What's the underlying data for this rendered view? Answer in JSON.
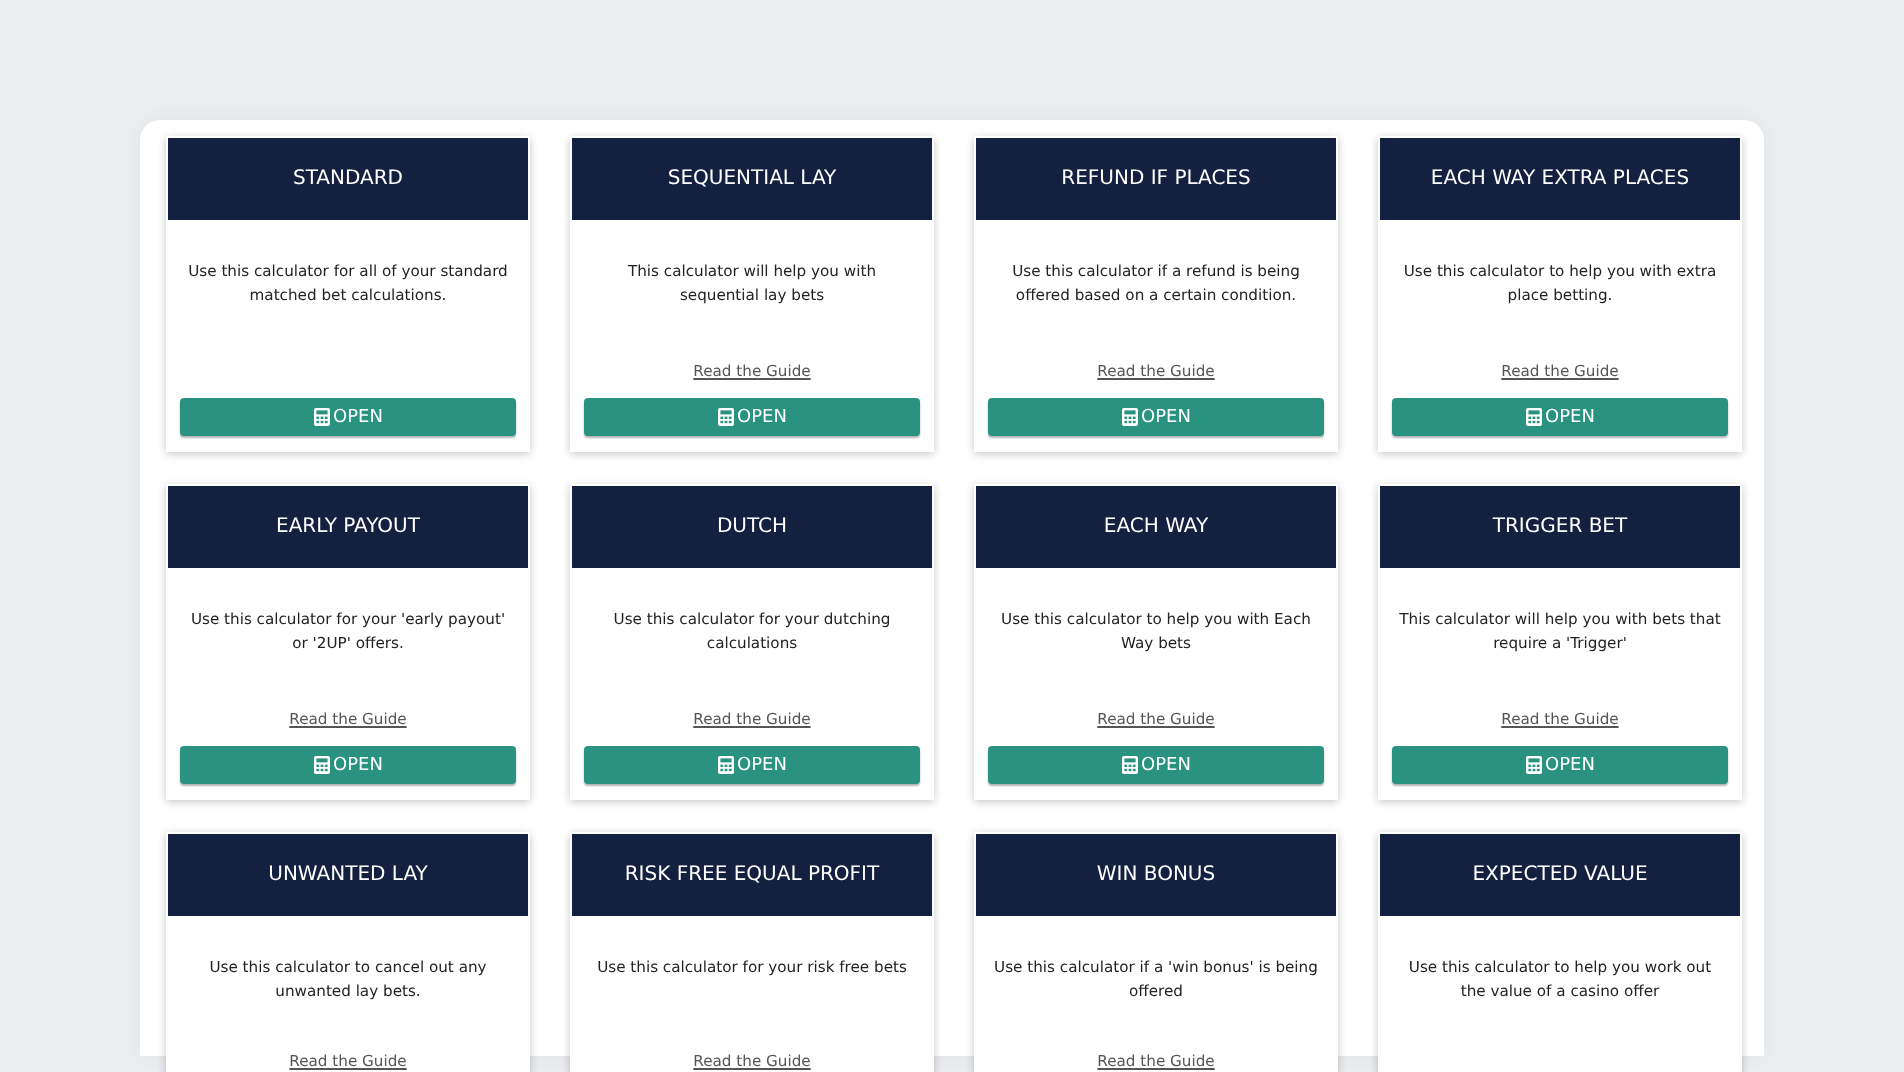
{
  "calculators": [
    {
      "title": "STANDARD",
      "description": "Use this calculator for all of your standard matched bet calculations.",
      "button": "OPEN"
    },
    {
      "title": "SEQUENTIAL LAY",
      "description": "This calculator will help you with sequential lay bets",
      "guide_link": "Read the Guide",
      "button": "OPEN"
    },
    {
      "title": "REFUND IF PLACES",
      "description": "Use this calculator if a refund is being offered based on a certain condition.",
      "guide_link": "Read the Guide",
      "button": "OPEN"
    },
    {
      "title": "EACH WAY EXTRA PLACES",
      "description": "Use this calculator to help you with extra place betting.",
      "guide_link": "Read the Guide",
      "button": "OPEN"
    },
    {
      "title": "EARLY PAYOUT",
      "description": "Use this calculator for your 'early payout' or '2UP' offers.",
      "guide_link": "Read the Guide",
      "button": "OPEN"
    },
    {
      "title": "DUTCH",
      "description": "Use this calculator for your dutching calculations",
      "guide_link": "Read the Guide",
      "button": "OPEN"
    },
    {
      "title": "EACH WAY",
      "description": "Use this calculator to help you with Each Way bets",
      "guide_link": "Read the Guide",
      "button": "OPEN"
    },
    {
      "title": "TRIGGER BET",
      "description": "This calculator will help you with bets that require a 'Trigger'",
      "guide_link": "Read the Guide",
      "button": "OPEN"
    },
    {
      "title": "UNWANTED LAY",
      "description": "Use this calculator to cancel out any unwanted lay bets.",
      "guide_link": "Read the Guide"
    },
    {
      "title": "RISK FREE EQUAL PROFIT",
      "description": "Use this calculator for your risk free bets",
      "guide_link": "Read the Guide"
    },
    {
      "title": "WIN BONUS",
      "description": "Use this calculator if a 'win bonus' is being offered",
      "guide_link": "Read the Guide"
    },
    {
      "title": "EXPECTED VALUE",
      "description": "Use this calculator to help you work out the value of a casino offer"
    }
  ]
}
